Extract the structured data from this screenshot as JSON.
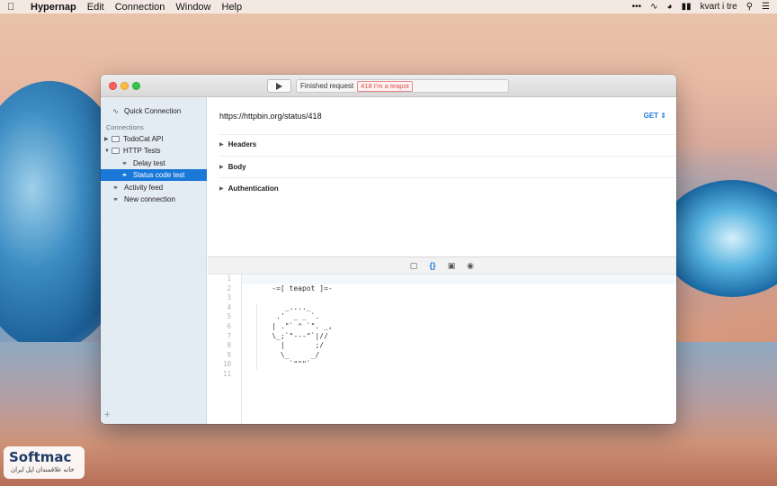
{
  "menubar": {
    "app_name": "Hypernap",
    "menus": [
      "Edit",
      "Connection",
      "Window",
      "Help"
    ],
    "status_items": {
      "more": "•••",
      "battery_icon": "battery-icon",
      "user": "kvart i tre"
    }
  },
  "window": {
    "toolbar": {
      "status_label": "Finished request",
      "status_badge": "418 I'm a teapot",
      "badge_color": "#e04b48"
    },
    "sidebar": {
      "quick_connection": "Quick Connection",
      "section_label": "Connections",
      "items": [
        {
          "label": "TodoCat API",
          "type": "folder",
          "expanded": false
        },
        {
          "label": "HTTP Tests",
          "type": "folder",
          "expanded": true
        },
        {
          "label": "Delay test",
          "type": "link",
          "child": true
        },
        {
          "label": "Status code test",
          "type": "link",
          "child": true,
          "selected": true
        },
        {
          "label": "Activity feed",
          "type": "link"
        },
        {
          "label": "New connection",
          "type": "link"
        }
      ],
      "add_button": "+"
    },
    "request": {
      "url": "https://httpbin.org/status/418",
      "method": "GET",
      "sections": [
        "Headers",
        "Body",
        "Authentication"
      ]
    },
    "response": {
      "line_numbers": [
        "1",
        "2",
        "3",
        "4",
        "5",
        "6",
        "7",
        "8",
        "9",
        "10",
        "11"
      ],
      "lines": [
        "",
        "    -=[ teapot ]=-",
        "",
        "       _...._",
        "     .'  _ _ `.",
        "    | .\"` ^ `\". _,",
        "    \\_;`\"---\"`|//",
        "      |       ;/",
        "      \\_     _/",
        "        `\"\"\"`",
        ""
      ]
    }
  },
  "watermark": {
    "name": "Softmac",
    "subtitle": "خانه علاقمندان اپل ایران"
  },
  "colors": {
    "accent": "#1a78d8",
    "selection": "#1a78d8"
  }
}
